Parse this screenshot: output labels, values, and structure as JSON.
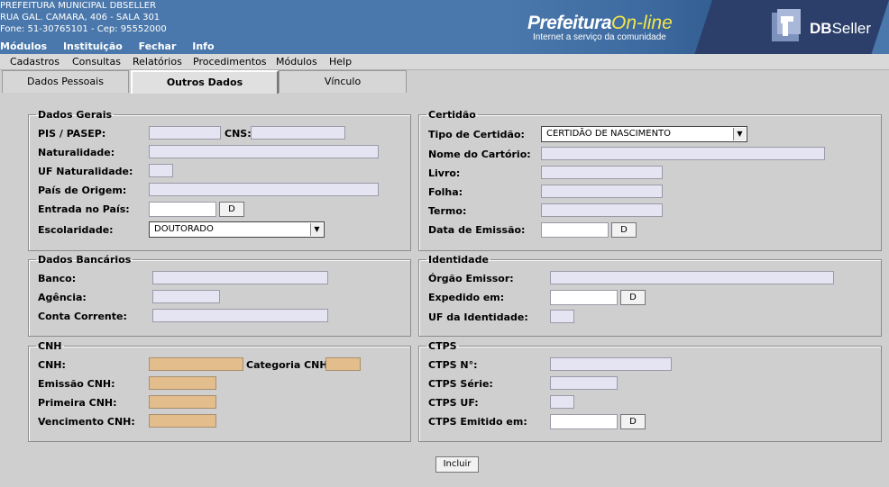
{
  "header": {
    "line1": "PREFEITURA MUNICIPAL DBSELLER",
    "line2": "RUA GAL. CAMARA, 406 - SALA 301",
    "line3": "Fone: 51-30765101  -  Cep: 95552000",
    "menu": [
      "Módulos",
      "Instituição",
      "Fechar",
      "Info"
    ],
    "logo_left": {
      "part1": "Prefeitura",
      "part2": "On-line",
      "subtitle": "Internet a serviço da comunidade"
    },
    "logo_right": {
      "bold": "DB",
      "rest": "Seller"
    }
  },
  "menubar": [
    "Cadastros",
    "Consultas",
    "Relatórios",
    "Procedimentos",
    "Módulos",
    "Help"
  ],
  "tabs": [
    "Dados Pessoais",
    "Outros Dados",
    "Vínculo"
  ],
  "dados_gerais": {
    "legend": "Dados Gerais",
    "pis": "PIS / PASEP:",
    "cns": "CNS:",
    "naturalidade": "Naturalidade:",
    "uf_naturalidade": "UF Naturalidade:",
    "pais_origem": "País de Origem:",
    "entrada_pais": "Entrada no País:",
    "escolaridade": "Escolaridade:",
    "escolaridade_value": "DOUTORADO"
  },
  "certidao": {
    "legend": "Certidão",
    "tipo": "Tipo de Certidão:",
    "tipo_value": "CERTIDÃO DE NASCIMENTO",
    "cartorio": "Nome do Cartório:",
    "livro": "Livro:",
    "folha": "Folha:",
    "termo": "Termo:",
    "data_emissao": "Data de Emissão:"
  },
  "bancarios": {
    "legend": "Dados Bancários",
    "banco": "Banco:",
    "agencia": "Agência:",
    "conta": "Conta Corrente:"
  },
  "identidade": {
    "legend": "Identidade",
    "orgao": "Órgão Emissor:",
    "expedido": "Expedido em:",
    "uf": "UF da Identidade:"
  },
  "cnh": {
    "legend": "CNH",
    "cnh": "CNH:",
    "categoria": "Categoria CNH:",
    "emissao": "Emissão CNH:",
    "primeira": "Primeira CNH:",
    "vencimento": "Vencimento CNH:"
  },
  "ctps": {
    "legend": "CTPS",
    "numero": "CTPS N°:",
    "serie": "CTPS Série:",
    "uf": "CTPS UF:",
    "emitido": "CTPS Emitido em:"
  },
  "buttons": {
    "date": "D",
    "incluir": "Incluir"
  },
  "colors": {
    "header_blue": "#4a78ac",
    "field_bg": "#e4e4f2",
    "cnh_field_bg": "#e3bd8c"
  }
}
